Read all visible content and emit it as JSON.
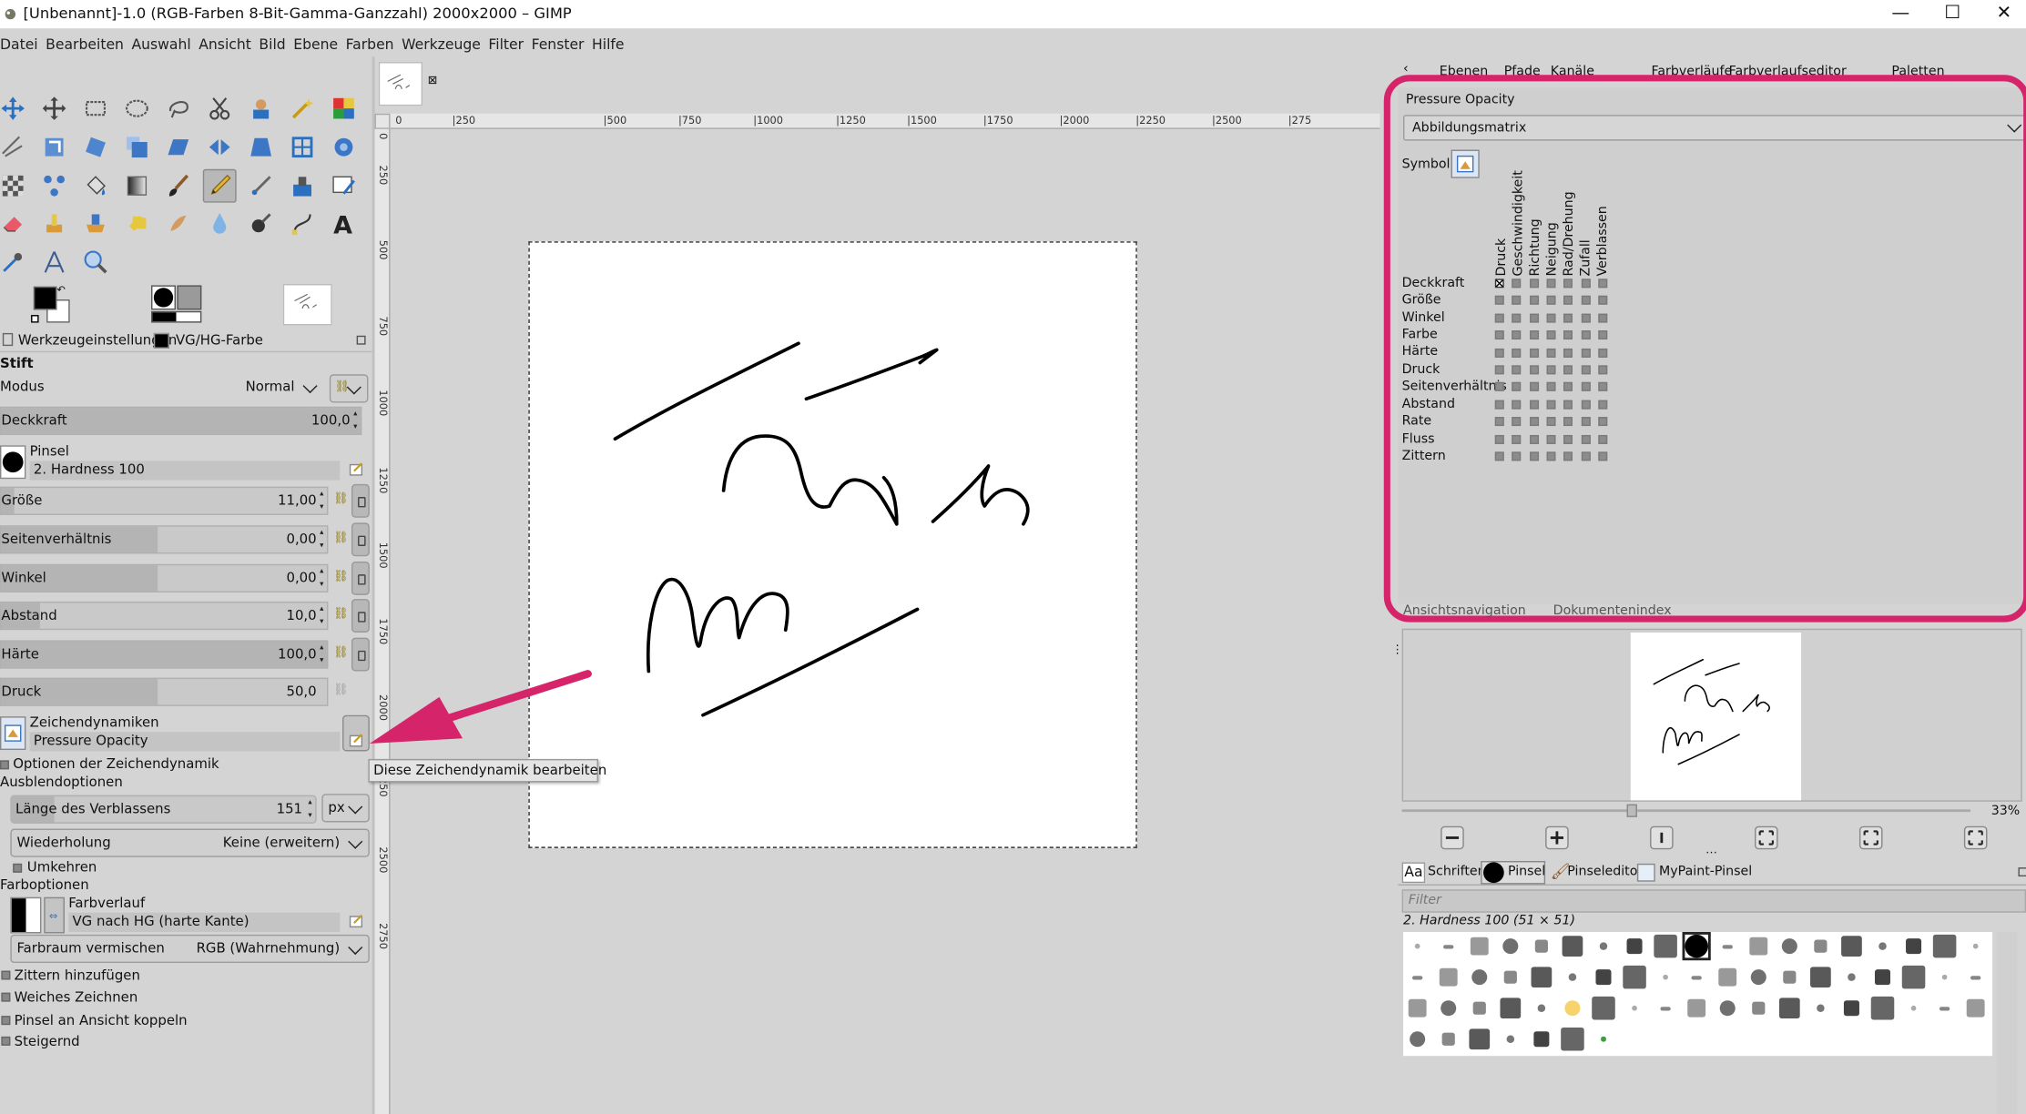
{
  "window": {
    "title": "[Unbenannt]-1.0 (RGB-Farben 8-Bit-Gamma-Ganzzahl) 2000x2000 – GIMP",
    "minimize": "—",
    "maximize": "☐",
    "close": "✕"
  },
  "menu": [
    "Datei",
    "Bearbeiten",
    "Auswahl",
    "Ansicht",
    "Bild",
    "Ebene",
    "Farben",
    "Werkzeuge",
    "Filter",
    "Fenster",
    "Hilfe"
  ],
  "tool_options": {
    "tab_tool": "Werkzeugeinstellungen",
    "tab_colors": "VG/HG-Farbe",
    "tool_name": "Stift",
    "mode_label": "Modus",
    "mode_value": "Normal",
    "opacity": {
      "label": "Deckkraft",
      "value": "100,0",
      "fill": 1.0
    },
    "brush_label": "Pinsel",
    "brush_value": "2. Hardness 100",
    "size": {
      "label": "Größe",
      "value": "11,00",
      "fill": 0.04
    },
    "aspect": {
      "label": "Seitenverhältnis",
      "value": "0,00",
      "fill": 0.5
    },
    "angle": {
      "label": "Winkel",
      "value": "0,00",
      "fill": 0.5
    },
    "spacing": {
      "label": "Abstand",
      "value": "10,0",
      "fill": 0.1
    },
    "hardness": {
      "label": "Härte",
      "value": "100,0",
      "fill": 1.0
    },
    "force": {
      "label": "Druck",
      "value": "50,0",
      "fill": 0.5
    },
    "dynamics_label": "Zeichendynamiken",
    "dynamics_value": "Pressure Opacity",
    "dynamics_options": "Optionen der Zeichendynamik",
    "fade_options": "Ausblendoptionen",
    "fade_length_label": "Länge des Verblassens",
    "fade_length_value": "151",
    "fade_unit": "px",
    "repeat_label": "Wiederholung",
    "repeat_value": "Keine (erweitern)",
    "reverse": "Umkehren",
    "color_options": "Farboptionen",
    "gradient_label": "Farbverlauf",
    "gradient_value": "VG nach HG (harte Kante)",
    "blend_space_label": "Farbraum vermischen",
    "blend_space_value": "RGB (Wahrnehmung)",
    "jitter": "Zittern hinzufügen",
    "smooth": "Weiches Zeichnen",
    "lock_view": "Pinsel an Ansicht koppeln",
    "incremental": "Steigernd"
  },
  "tooltip": "Diese Zeichendynamik bearbeiten",
  "ruler_h": [
    "0",
    "|250",
    "|500",
    "|750",
    "|1000",
    "|1250",
    "|1500",
    "|1750",
    "|2000",
    "|2250",
    "|2500",
    "|275"
  ],
  "ruler_v": [
    "0",
    "250",
    "500",
    "750",
    "1000",
    "1250",
    "1500",
    "1750",
    "2000",
    "2250",
    "2500",
    "2750"
  ],
  "dock_top_tabs": [
    "Ebenen",
    "Pfade",
    "Kanäle",
    "Farbverläufe",
    "Farbverlaufseditor",
    "Paletten"
  ],
  "dynamics_editor": {
    "name": "Pressure Opacity",
    "view": "Abbildungsmatrix",
    "symbol_label": "Symbol:",
    "columns": [
      "Druck",
      "Geschwindigkeit",
      "Richtung",
      "Neigung",
      "Rad/Drehung",
      "Zufall",
      "Verblassen"
    ],
    "rows": [
      "Deckkraft",
      "Größe",
      "Winkel",
      "Farbe",
      "Härte",
      "Druck",
      "Seitenverhältnis",
      "Abstand",
      "Rate",
      "Fluss",
      "Zittern"
    ],
    "checked": [
      [
        0,
        0
      ]
    ]
  },
  "navigation": {
    "tab1": "Ansichtsnavigation",
    "tab2": "Dokumentenindex",
    "zoom": "33%"
  },
  "brushes": {
    "tabs": [
      "Schriften",
      "Pinsel",
      "Pinseleditor",
      "MyPaint-Pinsel"
    ],
    "filter_placeholder": "Filter",
    "selected": "2. Hardness 100 (51 × 51)"
  },
  "colors": {
    "accent": "#d6246a",
    "canvas_bg": "#d4d4d4"
  }
}
